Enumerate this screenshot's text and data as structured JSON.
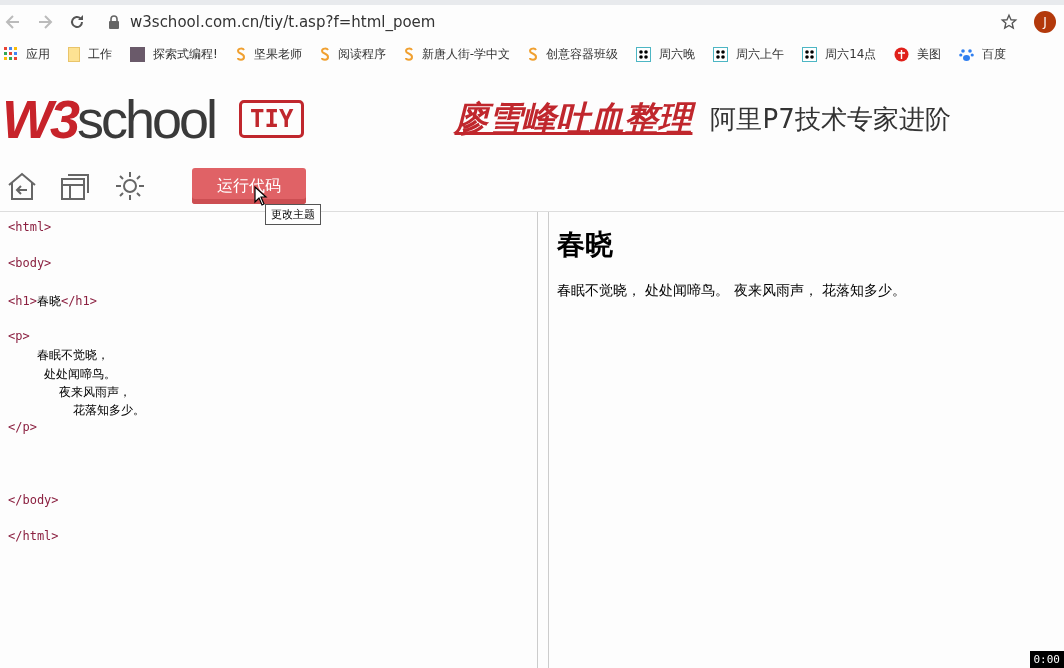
{
  "browser": {
    "url": "w3school.com.cn/tiy/t.asp?f=html_poem",
    "avatar": "J",
    "bookmarks": [
      {
        "kind": "apps",
        "label": "应用"
      },
      {
        "kind": "folder",
        "label": "工作"
      },
      {
        "kind": "thumb",
        "label": "探索式编程!"
      },
      {
        "kind": "s",
        "label": "坚果老师"
      },
      {
        "kind": "s",
        "label": "阅读程序"
      },
      {
        "kind": "s",
        "label": "新唐人街-学中文"
      },
      {
        "kind": "s",
        "label": "创意容器班级"
      },
      {
        "kind": "dots",
        "label": "周六晚"
      },
      {
        "kind": "dots",
        "label": "周六上午"
      },
      {
        "kind": "dots",
        "label": "周六14点"
      },
      {
        "kind": "xiu",
        "label": "美图"
      },
      {
        "kind": "paw",
        "label": "百度"
      }
    ]
  },
  "header": {
    "logo_red": "W3",
    "logo_dark": "school",
    "badge": "TIY",
    "link": "廖雪峰吐血整理",
    "slogan": "阿里P7技术专家进阶"
  },
  "toolbar": {
    "run_button": "运行代码",
    "tooltip": "更改主题"
  },
  "editor": {
    "lines": [
      {
        "kind": "code",
        "segments": [
          {
            "kind": "tag",
            "text": "<html>"
          }
        ]
      },
      {
        "kind": "blank"
      },
      {
        "kind": "code",
        "segments": [
          {
            "kind": "tag",
            "text": "<body>"
          }
        ]
      },
      {
        "kind": "blank"
      },
      {
        "kind": "code",
        "segments": [
          {
            "kind": "tag",
            "text": "<h1>"
          },
          {
            "kind": "text",
            "text": "春晓"
          },
          {
            "kind": "tag",
            "text": "</h1>"
          }
        ]
      },
      {
        "kind": "blank"
      },
      {
        "kind": "code",
        "segments": [
          {
            "kind": "tag",
            "text": "<p>"
          }
        ]
      },
      {
        "kind": "code",
        "segments": [
          {
            "kind": "text",
            "text": "    春眠不觉晓，"
          }
        ]
      },
      {
        "kind": "code",
        "segments": [
          {
            "kind": "text",
            "text": "     处处闻啼鸟。"
          }
        ]
      },
      {
        "kind": "code",
        "segments": [
          {
            "kind": "text",
            "text": "       夜来风雨声，"
          }
        ]
      },
      {
        "kind": "code",
        "segments": [
          {
            "kind": "text",
            "text": "         花落知多少。"
          }
        ]
      },
      {
        "kind": "code",
        "segments": [
          {
            "kind": "tag",
            "text": "</p>"
          }
        ]
      },
      {
        "kind": "blank"
      },
      {
        "kind": "blank"
      },
      {
        "kind": "blank"
      },
      {
        "kind": "code",
        "segments": [
          {
            "kind": "tag",
            "text": "</body>"
          }
        ]
      },
      {
        "kind": "blank"
      },
      {
        "kind": "code",
        "segments": [
          {
            "kind": "tag",
            "text": "</html>"
          }
        ]
      }
    ]
  },
  "preview": {
    "heading": "春晓",
    "paragraph": "春眠不觉晓， 处处闻啼鸟。 夜来风雨声， 花落知多少。"
  },
  "timer": "0:00"
}
